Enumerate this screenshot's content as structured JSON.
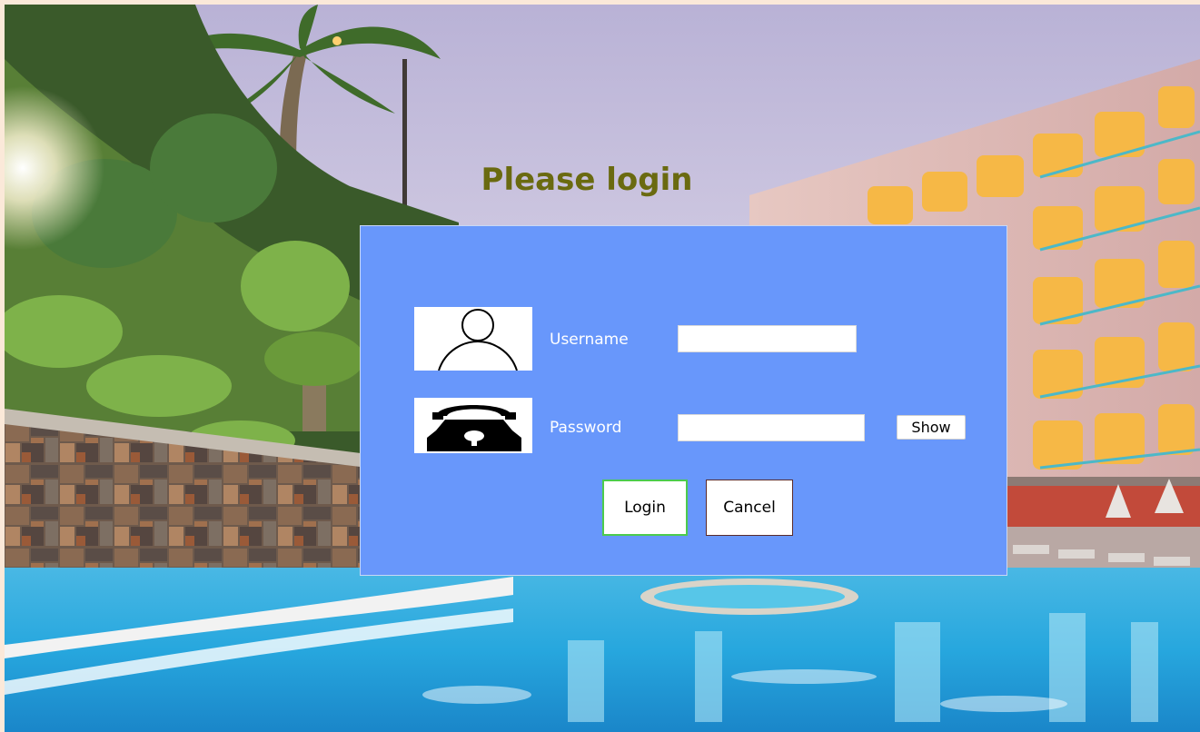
{
  "page": {
    "title": "Please login"
  },
  "form": {
    "username_label": "Username",
    "username_value": "",
    "password_label": "Password",
    "password_value": "",
    "show_label": "Show",
    "login_label": "Login",
    "cancel_label": "Cancel"
  },
  "icons": {
    "user": "user-icon",
    "lock": "lock-icon"
  },
  "colors": {
    "panel": "#6897fb",
    "title": "#6a6a10",
    "login_border": "#4ccb4c",
    "cancel_border": "#5a2a2a"
  }
}
